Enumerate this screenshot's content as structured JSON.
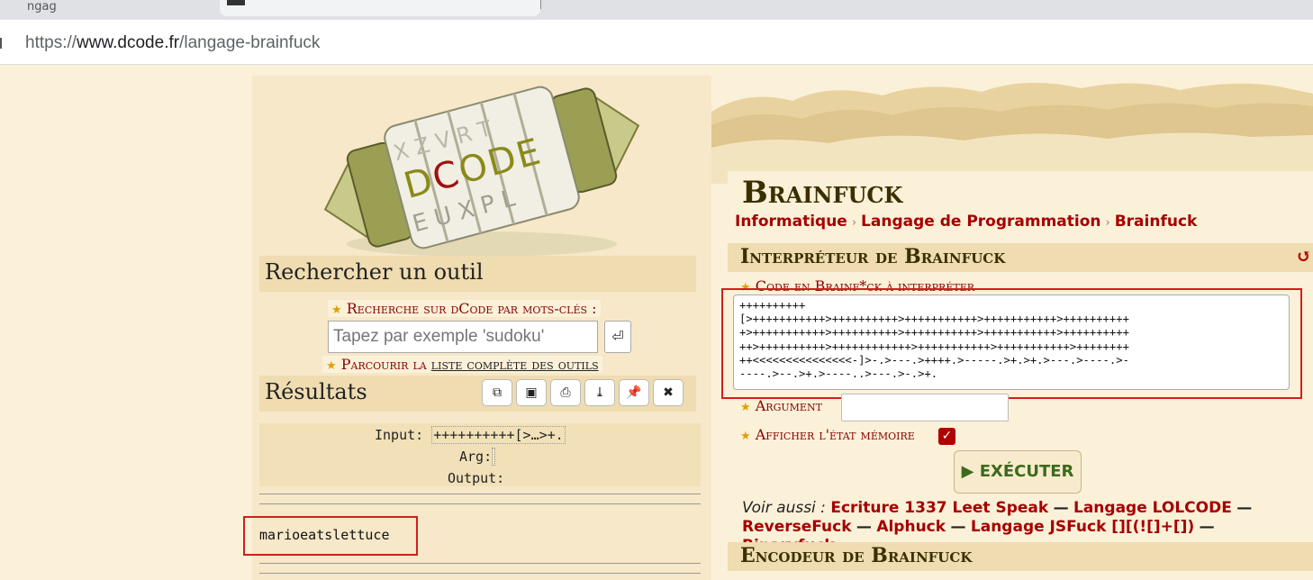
{
  "browser": {
    "tab1_title": "ngag",
    "url_prefix": "https://",
    "url_host": "www.dcode.fr",
    "url_path": "/langage-brainfuck"
  },
  "sidebar": {
    "logo_alt": "dCode",
    "search_section_title": "Rechercher un outil",
    "keyword_search_label": "Recherche sur dCode par mots-clés :",
    "search_placeholder": "Tapez par exemple 'sudoku'",
    "browse_prefix": "Parcourir la",
    "browse_link": "liste complète des outils",
    "results_title": "Résultats",
    "result_input_label": "Input:",
    "result_input_value": "++++++++++[>…>+.",
    "result_arg_label": "Arg:",
    "result_output_label": "Output:",
    "output_text": "marioeatslettuce",
    "tools": [
      "copy-icon",
      "save-icon",
      "print-icon",
      "download-icon",
      "pin-icon",
      "close-icon"
    ]
  },
  "main": {
    "title": "Brainfuck",
    "breadcrumb": [
      "Informatique",
      "Langage de Programmation",
      "Brainfuck"
    ],
    "interpreter_title": "Interpréteur de Brainfuck",
    "code_label": "Code en Brainf*ck à interpréter",
    "code_value": "++++++++++\n[>+++++++++++>++++++++++>+++++++++++>+++++++++++>++++++++++\n+>+++++++++++>++++++++++>+++++++++++>+++++++++++>++++++++++\n++>++++++++++>++++++++++++>+++++++++++>+++++++++++>++++++++\n++<<<<<<<<<<<<<<<-]>-.>---.>++++.>-----.>+.>+.>---.>----.>-\n----.>--.>+.>----..>---.>-.>+.",
    "argument_label": "Argument",
    "argument_value": "",
    "memory_label": "Afficher l'état mémoire",
    "memory_checked": true,
    "execute_label": "▶ EXÉCUTER",
    "see_also_prefix": "Voir aussi :",
    "see_also": [
      "Ecriture 1337 Leet Speak",
      "Langage LOLCODE",
      "ReverseFuck",
      "Alphuck",
      "Langage JSFuck [][(![]+[])",
      "Binaryfuck"
    ],
    "encoder_title": "Encodeur de Brainfuck"
  }
}
